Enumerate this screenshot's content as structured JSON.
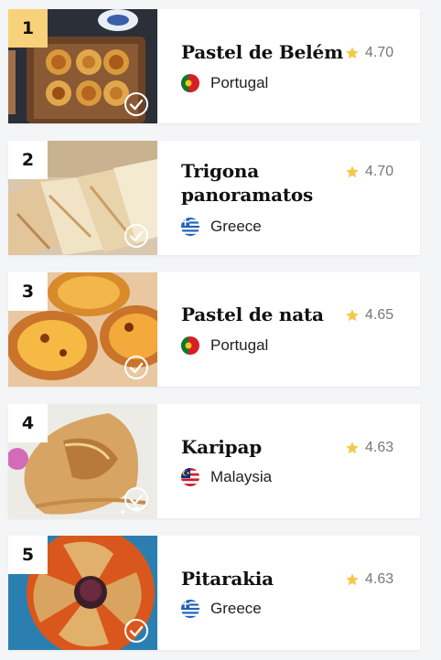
{
  "items": [
    {
      "rank": "1",
      "name": "Pastel de Belém",
      "rating": "4.70",
      "country": "Portugal",
      "flag": "portugal-flag-icon"
    },
    {
      "rank": "2",
      "name": "Trigona panoramatos",
      "rating": "4.70",
      "country": "Greece",
      "flag": "greece-flag-icon"
    },
    {
      "rank": "3",
      "name": "Pastel de nata",
      "rating": "4.65",
      "country": "Portugal",
      "flag": "portugal-flag-icon"
    },
    {
      "rank": "4",
      "name": "Karipap",
      "rating": "4.63",
      "country": "Malaysia",
      "flag": "malaysia-flag-icon"
    },
    {
      "rank": "5",
      "name": "Pitarakia",
      "rating": "4.63",
      "country": "Greece",
      "flag": "greece-flag-icon"
    }
  ],
  "colors": {
    "rank_highlight": "#f7d27a",
    "star": "#f5c84b",
    "rating_text": "#777777"
  },
  "icons": {
    "rating": "star-icon",
    "visited": "check-circle-icon"
  }
}
